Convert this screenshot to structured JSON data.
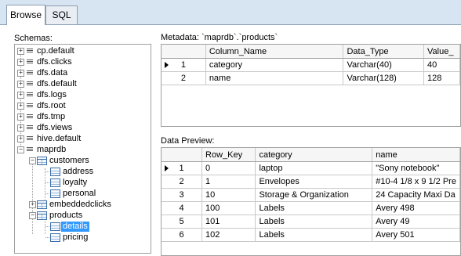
{
  "tabs": {
    "browse": "Browse",
    "sql": "SQL"
  },
  "schemas_label": "Schemas:",
  "tree": {
    "schemas": [
      "cp.default",
      "dfs.clicks",
      "dfs.data",
      "dfs.default",
      "dfs.logs",
      "dfs.root",
      "dfs.tmp",
      "dfs.views",
      "hive.default",
      "maprdb"
    ],
    "tables": [
      "customers",
      "embeddedclicks",
      "products"
    ],
    "customer_columns": [
      "address",
      "loyalty",
      "personal"
    ],
    "product_columns": [
      "details",
      "pricing"
    ],
    "selected": "details"
  },
  "metadata": {
    "label": "Metadata: `maprdb`.`products`",
    "headers": [
      "Column_Name",
      "Data_Type",
      "Value_"
    ],
    "rows": [
      {
        "num": "1",
        "c1": "category",
        "c2": "Varchar(40)",
        "c3": "40"
      },
      {
        "num": "2",
        "c1": "name",
        "c2": "Varchar(128)",
        "c3": "128"
      }
    ]
  },
  "preview": {
    "label": "Data Preview:",
    "headers": [
      "Row_Key",
      "category",
      "name"
    ],
    "rows": [
      {
        "num": "1",
        "c1": "0",
        "c2": "laptop",
        "c3": "\"Sony notebook\""
      },
      {
        "num": "2",
        "c1": "1",
        "c2": "Envelopes",
        "c3": "#10-4 1/8 x 9 1/2 Pre"
      },
      {
        "num": "3",
        "c1": "10",
        "c2": "Storage & Organization",
        "c3": "24 Capacity Maxi Da"
      },
      {
        "num": "4",
        "c1": "100",
        "c2": "Labels",
        "c3": "Avery 498"
      },
      {
        "num": "5",
        "c1": "101",
        "c2": "Labels",
        "c3": "Avery 49"
      },
      {
        "num": "6",
        "c1": "102",
        "c2": "Labels",
        "c3": "Avery 501"
      }
    ]
  }
}
